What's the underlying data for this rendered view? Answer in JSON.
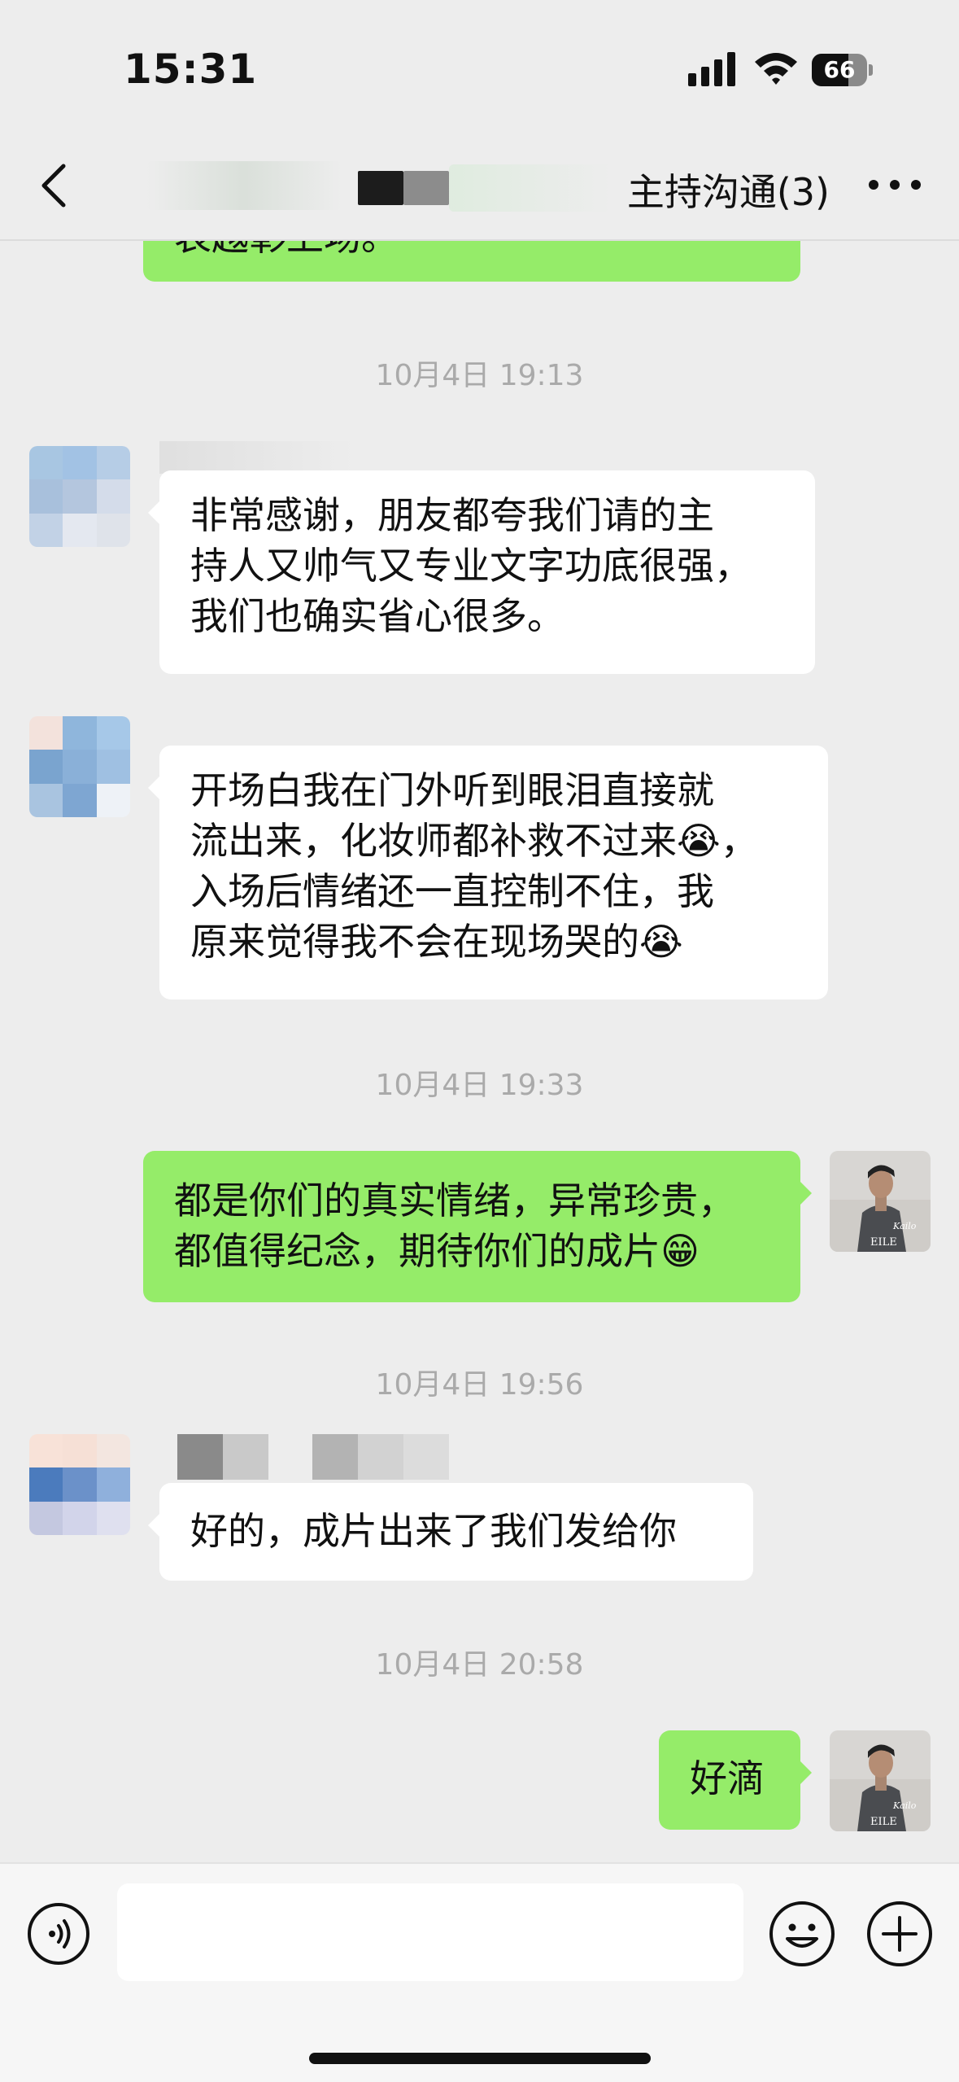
{
  "status_bar": {
    "time": "15:31",
    "battery_text": "66",
    "battery_level": 0.66
  },
  "nav": {
    "title": "主持沟通(3)",
    "back_icon": "chevron-left-icon",
    "more_icon": "more-dots-icon"
  },
  "messages": {
    "partial_top": "表越彰上场。",
    "ts1": "10月4日 19:13",
    "msg1": [
      "非常感谢，朋友都夸我们请的主",
      "持人又帅气又专业文字功底很强，",
      "我们也确实省心很多。"
    ],
    "msg2": [
      "开场白我在门外听到眼泪直接就",
      "流出来，化妆师都补救不过来😭，",
      "入场后情绪还一直控制不住，我",
      "原来觉得我不会在现场哭的😭"
    ],
    "ts2": "10月4日 19:33",
    "msg3": [
      "都是你们的真实情绪，异常珍贵，",
      "都值得纪念，期待你们的成片😁"
    ],
    "ts3": "10月4日 19:56",
    "msg4": [
      "好的，成片出来了我们发给你"
    ],
    "ts4": "10月4日 20:58",
    "msg5": [
      "好滴"
    ]
  },
  "avatar_self": {
    "signature_text": "Kailo",
    "brand_text": "EILE"
  },
  "input": {
    "value": "",
    "voice_icon": "voice-icon",
    "emoji_icon": "emoji-icon",
    "plus_icon": "plus-icon"
  },
  "colors": {
    "background": "#ededed",
    "bubble_out": "#95ec69",
    "bubble_in": "#ffffff",
    "timestamp": "#aaaaaa"
  }
}
